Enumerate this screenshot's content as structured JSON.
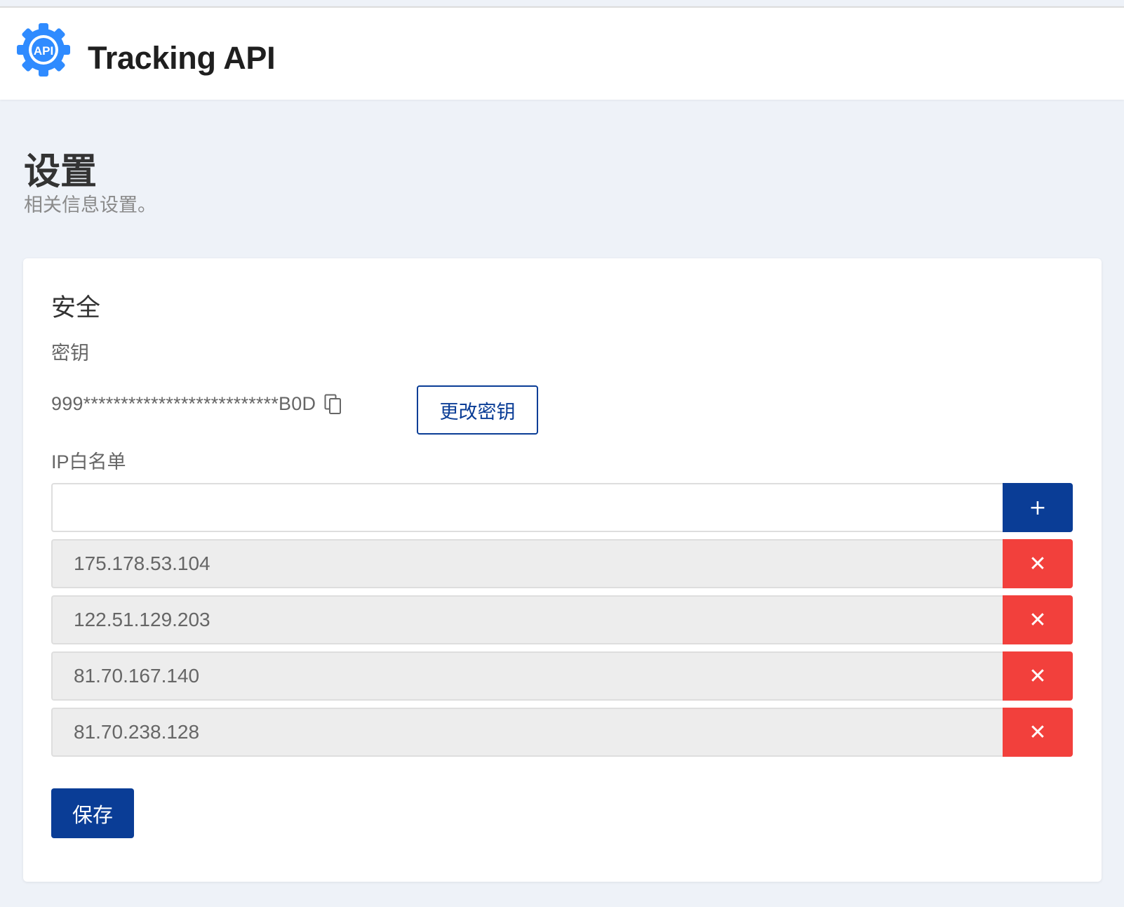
{
  "header": {
    "app_title": "Tracking API",
    "logo_text": "API",
    "logo_color": "#2f8bff"
  },
  "page": {
    "title": "设置",
    "subtitle": "相关信息设置。"
  },
  "security": {
    "section_title": "安全",
    "key_label": "密钥",
    "key_value": "999**************************B0D",
    "change_key_label": "更改密钥",
    "ip_label": "IP白名单",
    "new_ip_value": "",
    "add_label": "+",
    "remove_label": "✕",
    "ips": [
      "175.178.53.104",
      "122.51.129.203",
      "81.70.167.140",
      "81.70.238.128"
    ],
    "save_label": "保存"
  },
  "colors": {
    "primary": "#0a3d96",
    "danger": "#f2403c",
    "background": "#eef2f8"
  }
}
